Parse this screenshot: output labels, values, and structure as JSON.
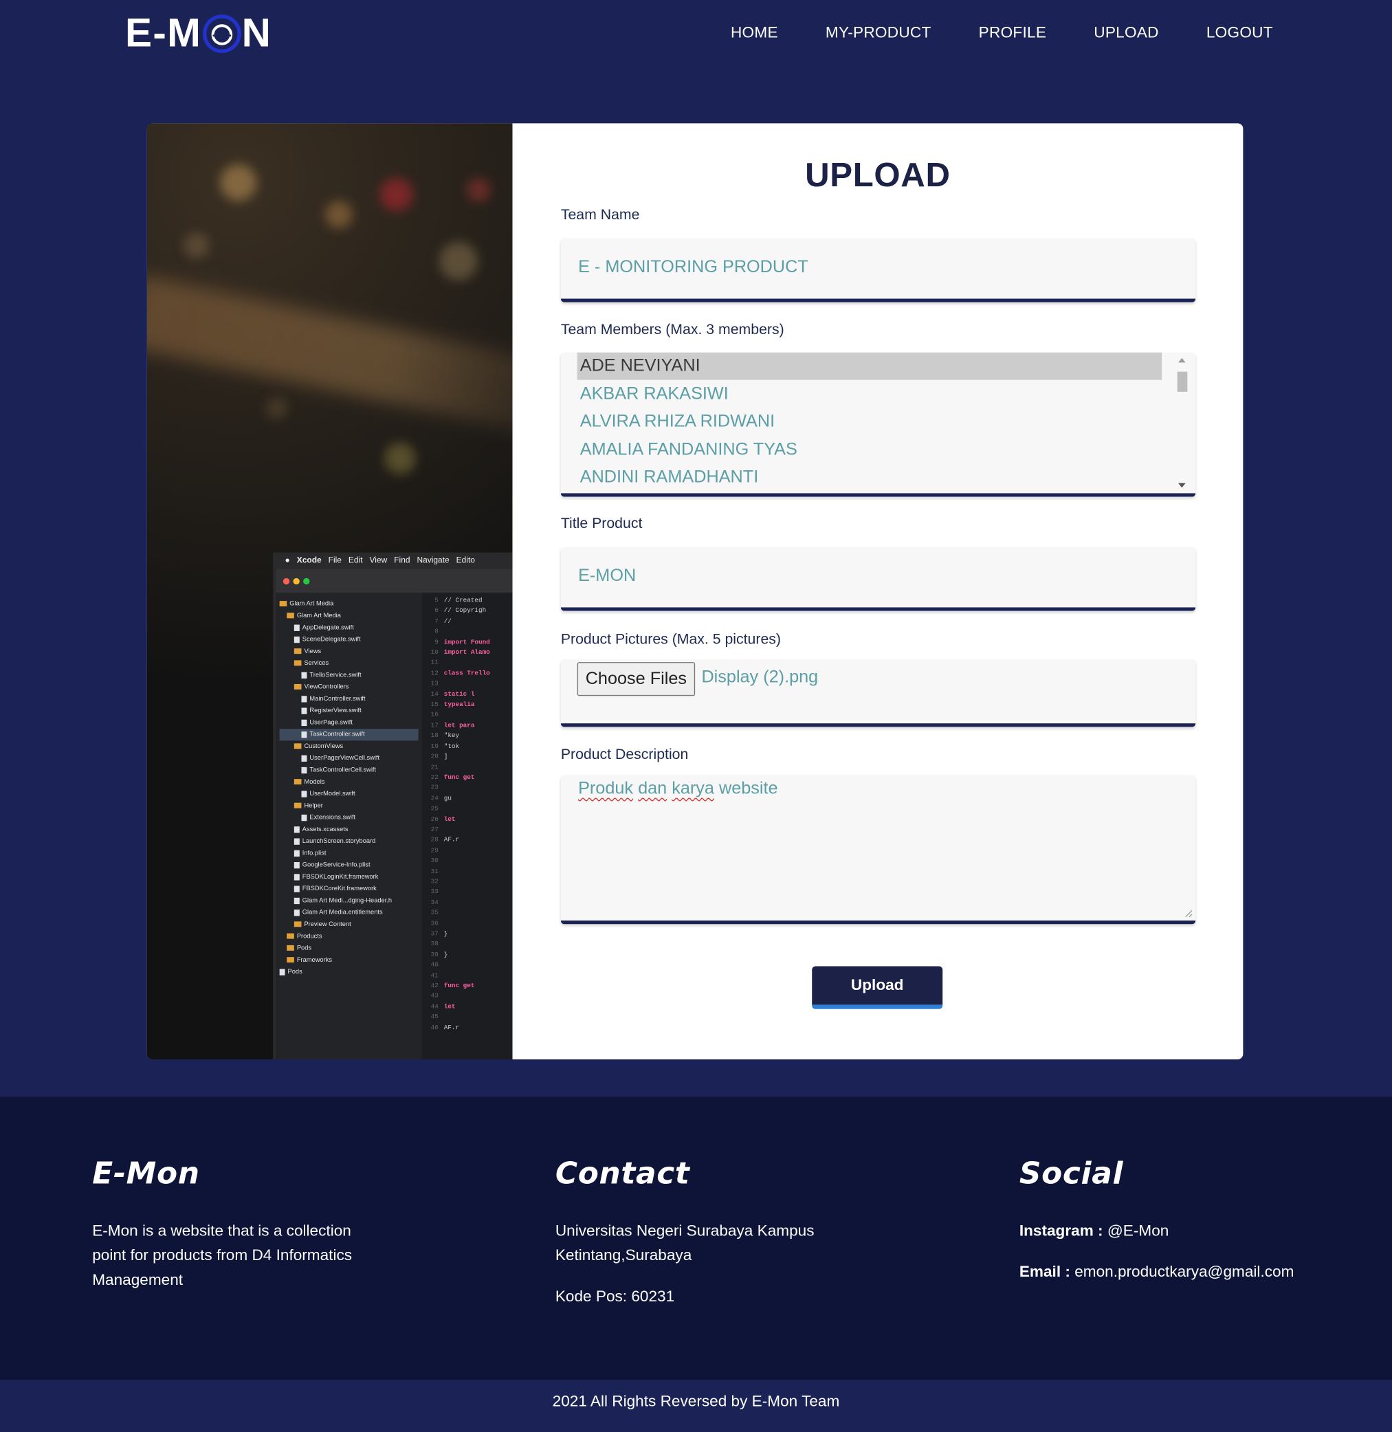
{
  "brand": {
    "logo_prefix": "E-M",
    "logo_suffix": "N"
  },
  "nav": {
    "items": [
      "HOME",
      "MY-PRODUCT",
      "PROFILE",
      "UPLOAD",
      "LOGOUT"
    ]
  },
  "form": {
    "title": "UPLOAD",
    "team_name": {
      "label": "Team Name",
      "value": "E - MONITORING PRODUCT"
    },
    "team_members": {
      "label": "Team Members (Max. 3 members)",
      "options": [
        "ADE NEVIYANI",
        "AKBAR RAKASIWI",
        "ALVIRA RHIZA RIDWANI",
        "AMALIA FANDANING TYAS",
        "ANDINI RAMADHANTI"
      ],
      "selected": "ADE NEVIYANI"
    },
    "title_product": {
      "label": "Title Product",
      "value": "E-MON"
    },
    "product_pictures": {
      "label": "Product Pictures (Max. 5 pictures)",
      "button_label": "Choose Files",
      "file_name": "Display (2).png"
    },
    "product_description": {
      "label": "Product Description",
      "value_words": [
        "Produk",
        "dan",
        "karya",
        "website"
      ]
    },
    "submit_label": "Upload"
  },
  "image_panel": {
    "menu": [
      "Xcode",
      "File",
      "Edit",
      "View",
      "Find",
      "Navigate",
      "Edito"
    ],
    "tree": [
      "Glam Art Media",
      "Glam Art Media",
      "AppDelegate.swift",
      "SceneDelegate.swift",
      "Views",
      "Services",
      "TrelloService.swift",
      "ViewControllers",
      "MainController.swift",
      "RegisterView.swift",
      "UserPage.swift",
      "TaskController.swift",
      "CustomViews",
      "UserPagerViewCell.swift",
      "TaskControllerCell.swift",
      "Models",
      "UserModel.swift",
      "Helper",
      "Extensions.swift",
      "Assets.xcassets",
      "LaunchScreen.storyboard",
      "Info.plist",
      "GoogleService-Info.plist",
      "FBSDKLoginKit.framework",
      "FBSDKCoreKit.framework",
      "Glam Art Medi...dging-Header.h",
      "Glam Art Media.entitlements",
      "Preview Content",
      "Products",
      "Pods",
      "Frameworks",
      "Pods"
    ],
    "code": [
      "// Created",
      "// Copyrigh",
      "//",
      "",
      "import Found",
      "import Alamo",
      "",
      "class Trello",
      "",
      "static l",
      "typealia",
      "",
      "let para",
      "\"key",
      "\"tok",
      "]",
      "",
      "func get",
      "",
      "gu",
      "",
      "let",
      "",
      "AF.r",
      "",
      "",
      "",
      "",
      "",
      "",
      "",
      "",
      "}",
      "",
      "}",
      "",
      "",
      "func get",
      "",
      "let",
      "",
      "AF.r"
    ]
  },
  "footer": {
    "about": {
      "heading": "E-Mon",
      "text_lines": [
        "E-Mon is a website that is a collection",
        "point for products from D4 Informatics",
        "Management"
      ]
    },
    "contact": {
      "heading": "Contact",
      "address_lines": [
        "Universitas Negeri Surabaya Kampus",
        "Ketintang,Surabaya"
      ],
      "postal": "Kode Pos: 60231"
    },
    "social": {
      "heading": "Social",
      "instagram_label": "Instagram :",
      "instagram_value": "@E-Mon",
      "email_label": "Email :",
      "email_value": "emon.productkarya@gmail.com"
    },
    "copyright": "2021 All Rights Reversed by E-Mon Team"
  },
  "colors": {
    "navy": "#1b2356",
    "footer_dark": "#0d1437",
    "field_text": "#5b9ea6",
    "accent_blue": "#2f7fd6"
  }
}
